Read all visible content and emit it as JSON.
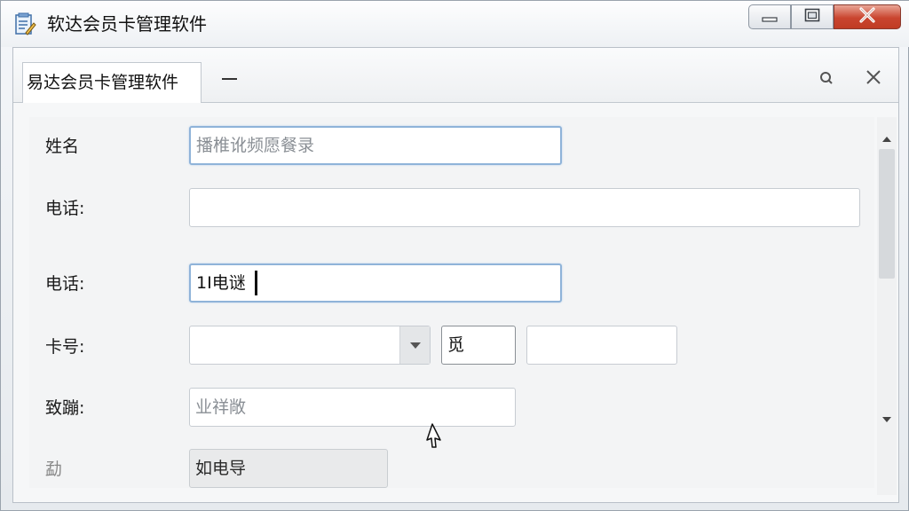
{
  "window": {
    "title": "软达会员卡管理软件"
  },
  "tab": {
    "label": "易达会员卡管理软件"
  },
  "form": {
    "name_label": "姓名",
    "name_placeholder": "播椎讹频愿餐录",
    "phone1_label": "电话:",
    "phone1_value": "",
    "phone2_label": "电话:",
    "phone2_value": "1I电谜",
    "card_label": "卡号:",
    "card_select_value": "",
    "card_small_value": "觅",
    "card_extra_value": "",
    "notes_label": "致蹦:",
    "notes_placeholder": "业祥敞",
    "bottom_label": "勐",
    "bottom_value": "如电导"
  },
  "icons": {
    "app": "notepad-icon",
    "minimize": "minimize-icon",
    "maximize": "maximize-icon",
    "close": "close-icon",
    "search": "search-icon",
    "dropdown": "chevron-down-icon",
    "cursor": "mouse-pointer-icon"
  }
}
